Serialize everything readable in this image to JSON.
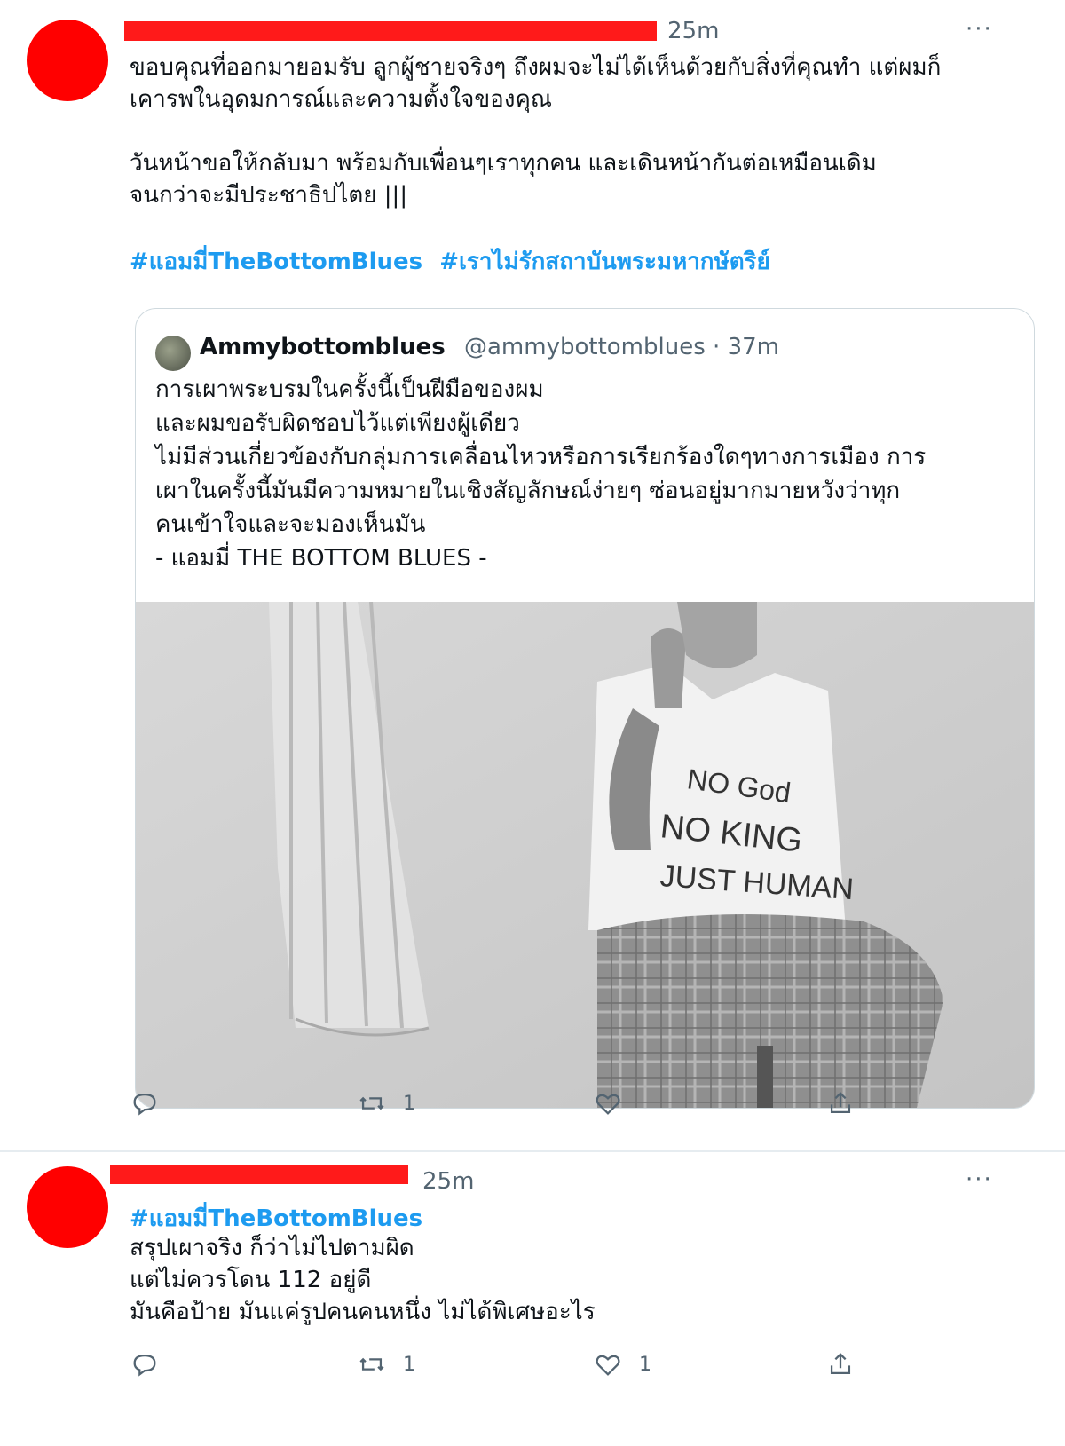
{
  "tweet1": {
    "time": "25m",
    "more": "···",
    "text": "ขอบคุณที่ออกมายอมรับ ลูกผู้ชายจริงๆ ถึงผมจะไม่ได้เห็นด้วยกับสิ่งที่คุณทำ แต่ผมก็\nเคารพในอุดมการณ์และความตั้งใจของคุณ\n\nวันหน้าขอให้กลับมา พร้อมกับเพื่อนๆเราทุกคน และเดินหน้ากันต่อเหมือนเดิม\nจนกว่าจะมีประชาธิปไตย |||",
    "hashtags": [
      "#แอมมี่TheBottomBlues",
      "#เราไม่รักสถาบันพระมหากษัตริย์"
    ],
    "quote": {
      "name": "Ammybottomblues",
      "handle": "@ammybottomblues · 37m",
      "text": "การเผาพระบรมในครั้งนี้เป็นฝีมือของผม\nและผมขอรับผิดชอบไว้แต่เพียงผู้เดียว\nไม่มีส่วนเกี่ยวข้องกับกลุ่มการเคลื่อนไหวหรือการเรียกร้องใดๆทางการเมือง การ\nเผาในครั้งนี้มันมีความหมายในเชิงสัญลักษณ์ง่ายๆ ซ่อนอยู่มากมายหวังว่าทุก\nคนเข้าใจและจะมองเห็นมัน\n- แอมมี่ THE BOTTOM BLUES -",
      "shirt_text": [
        "NO God",
        "NO KING",
        "JUST HUMAN"
      ]
    },
    "actions": {
      "reply": "",
      "retweet": "1",
      "like": "",
      "share": ""
    }
  },
  "tweet2": {
    "time": "25m",
    "more": "···",
    "hashtag": "#แอมมี่TheBottomBlues",
    "text": "สรุปเผาจริง ก็ว่าไม่ไปตามผิด\nแต่ไม่ควรโดน 112 อยู่ดี\nมันคือป้าย มันแค่รูปคนคนหนึ่ง ไม่ได้พิเศษอะไร",
    "actions": {
      "reply": "",
      "retweet": "1",
      "like": "1",
      "share": ""
    }
  },
  "colors": {
    "accent": "#1d9bf0",
    "redaction": "#ff0000",
    "muted": "#536471"
  },
  "icons": [
    "reply-icon",
    "retweet-icon",
    "like-icon",
    "share-icon",
    "more-icon"
  ]
}
